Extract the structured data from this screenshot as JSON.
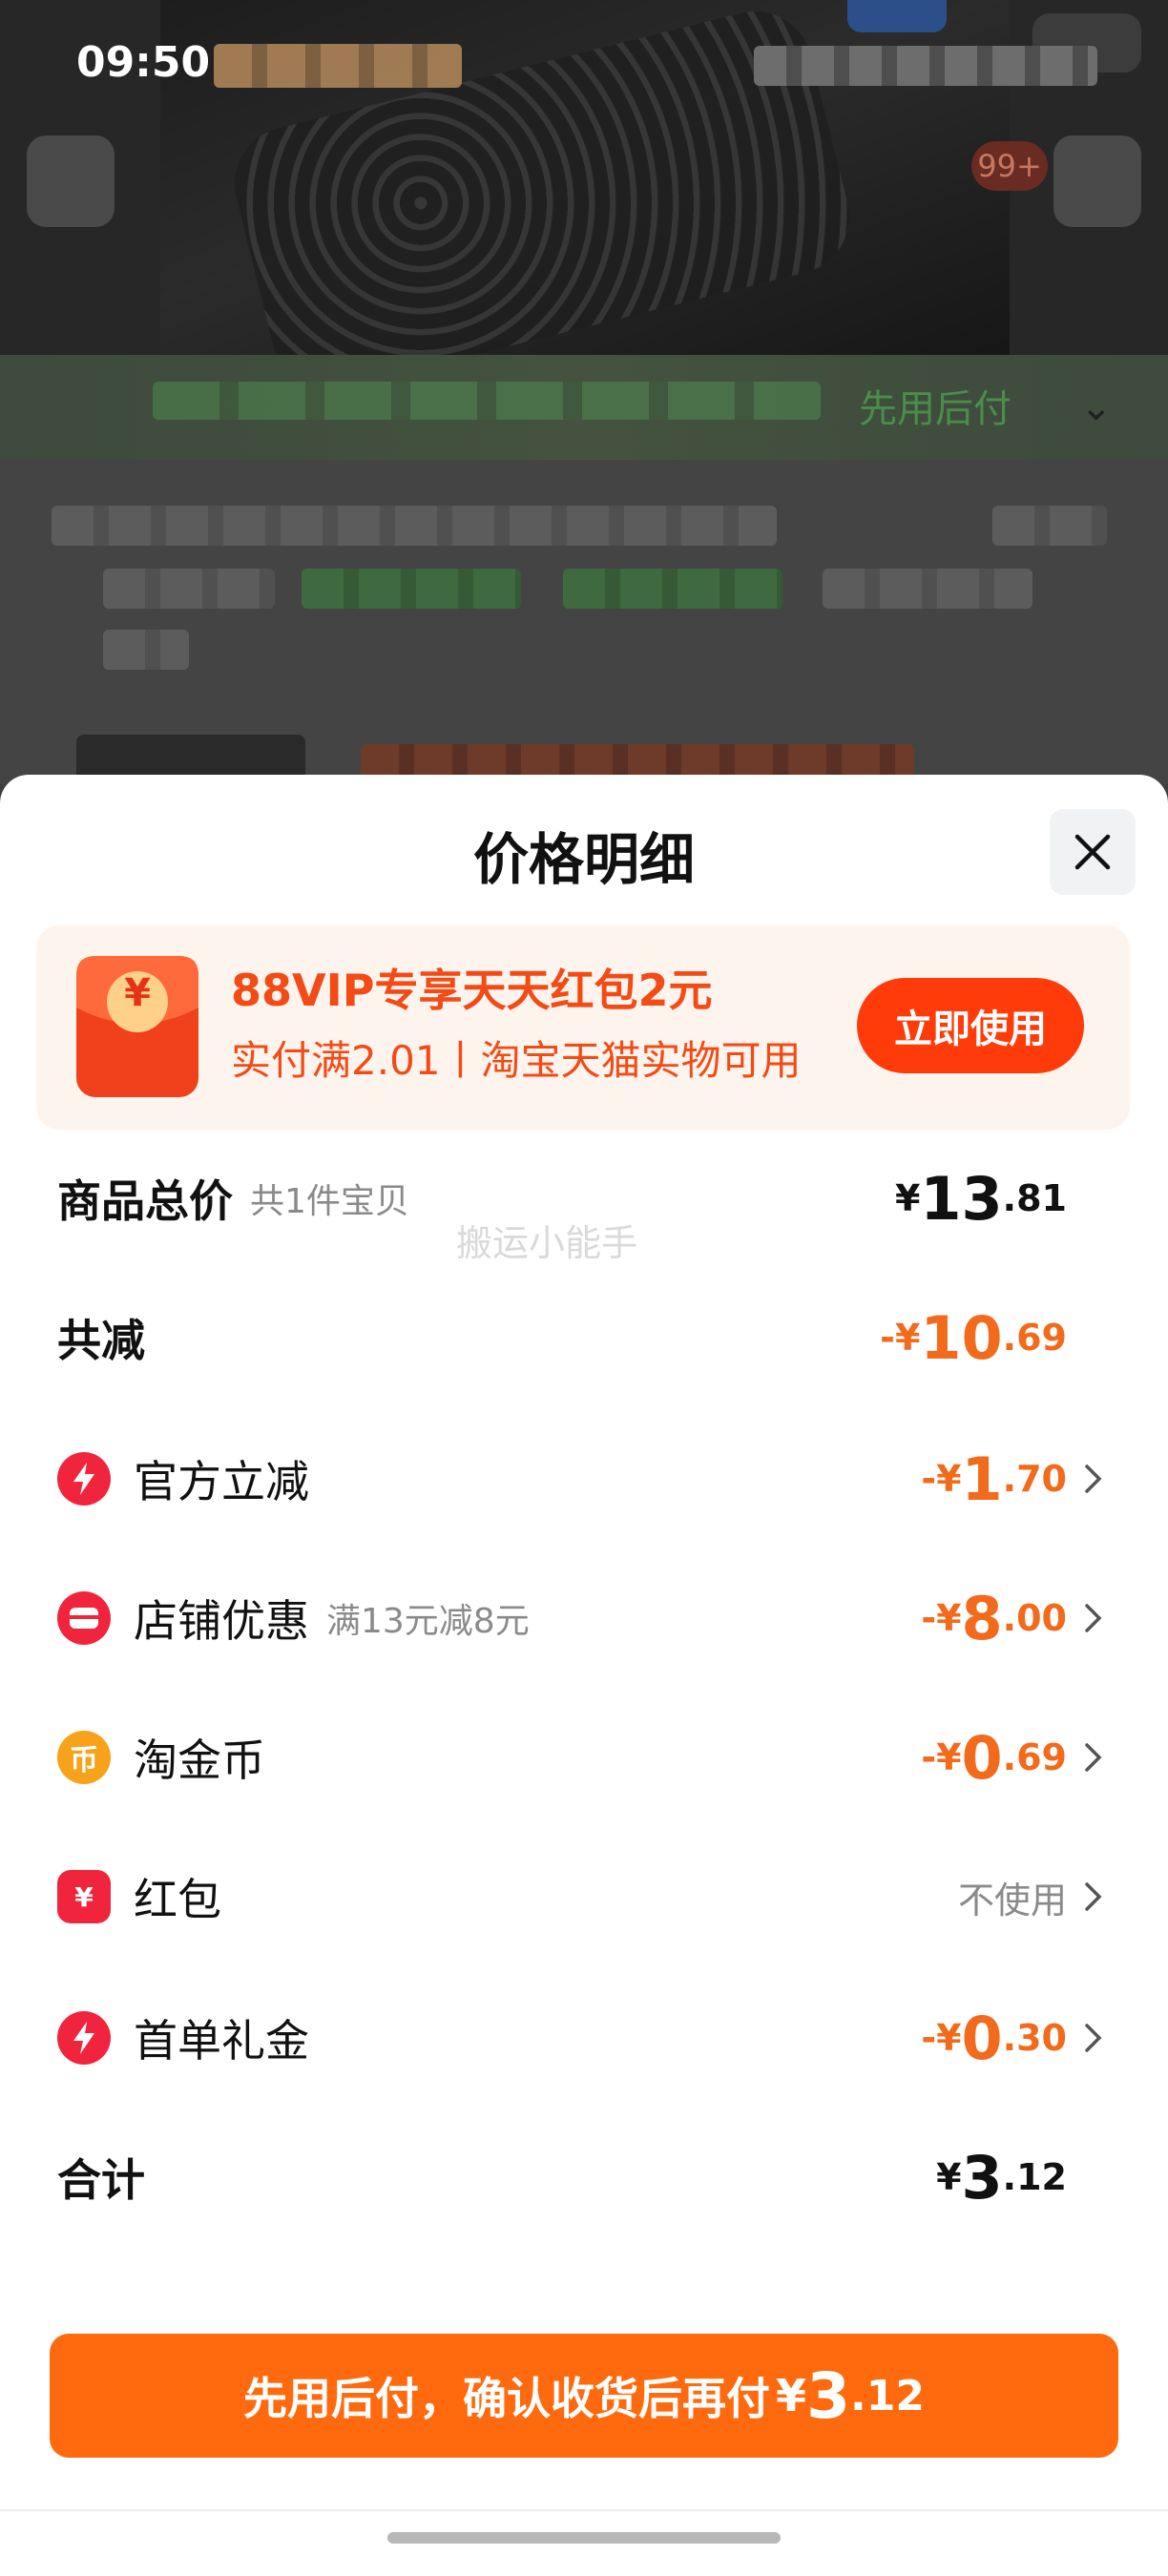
{
  "status_bar": {
    "time": "09:50"
  },
  "background": {
    "cart_badge": "99+",
    "green_label": "先用后付"
  },
  "sheet": {
    "title": "价格明细",
    "watermark": "搬运小能手"
  },
  "promo": {
    "title": "88VIP专享天天红包2元",
    "subtitle": "实付满2.01丨淘宝天猫实物可用",
    "button": "立即使用",
    "icon_glyph": "¥"
  },
  "rows": {
    "total": {
      "label": "商品总价",
      "sub": "共1件宝贝",
      "currency": "¥",
      "int": "13",
      "dec": ".81"
    },
    "reduce": {
      "label": "共减",
      "currency": "-¥",
      "int": "10",
      "dec": ".69"
    },
    "official": {
      "label": "官方立减",
      "currency": "-¥",
      "int": "1",
      "dec": ".70"
    },
    "store": {
      "label": "店铺优惠",
      "sub": "满13元减8元",
      "currency": "-¥",
      "int": "8",
      "dec": ".00"
    },
    "coin": {
      "label": "淘金币",
      "icon_glyph": "币",
      "currency": "-¥",
      "int": "0",
      "dec": ".69"
    },
    "redpacket": {
      "label": "红包",
      "icon_glyph": "¥",
      "value": "不使用"
    },
    "firstorder": {
      "label": "首单礼金",
      "currency": "-¥",
      "int": "0",
      "dec": ".30"
    },
    "sum": {
      "label": "合计",
      "currency": "¥",
      "int": "3",
      "dec": ".12"
    }
  },
  "cta": {
    "label": "先用后付，确认收货后再付",
    "currency": "¥",
    "int": "3",
    "dec": ".12"
  },
  "colors": {
    "accent_orange": "#ff6a0e",
    "promo_red": "#ff3b0a",
    "discount_orange": "#f26b1d"
  }
}
